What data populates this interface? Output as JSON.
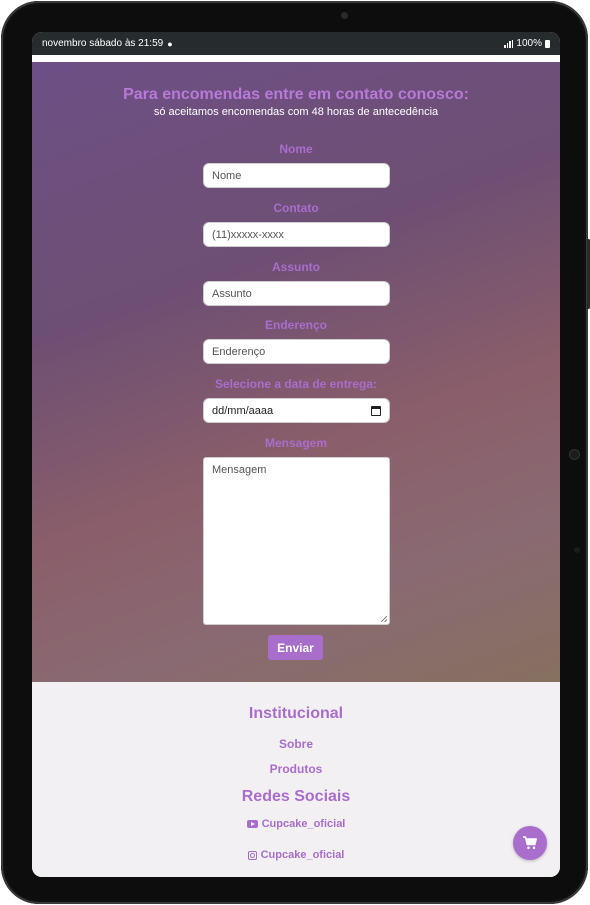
{
  "statusbar": {
    "time_text": "novembro sábado às 21:59",
    "notification_icon": "spotify-icon",
    "battery_text": "100%"
  },
  "header": {
    "title": "Para encomendas entre em contato conosco:",
    "subtitle": "só aceitamos encomendas com 48 horas de antecedência"
  },
  "form": {
    "name_label": "Nome",
    "name_placeholder": "Nome",
    "contact_label": "Contato",
    "contact_placeholder": "(11)xxxxx-xxxx",
    "subject_label": "Assunto",
    "subject_placeholder": "Assunto",
    "address_label": "Enderenço",
    "address_placeholder": "Enderenço",
    "date_label": "Selecione a data de entrega:",
    "date_placeholder": "dd/mm/aaaa",
    "message_label": "Mensagem",
    "message_placeholder": "Mensagem",
    "submit_label": "Enviar"
  },
  "footer": {
    "institutional_heading": "Institucional",
    "about_link": "Sobre",
    "products_link": "Produtos",
    "social_heading": "Redes Sociais",
    "youtube_handle": "Cupcake_oficial",
    "instagram_handle": "Cupcake_oficial"
  },
  "colors": {
    "accent": "#a96dcc",
    "statusbar_bg": "#262b2e",
    "footer_bg": "#f3f0f3"
  }
}
